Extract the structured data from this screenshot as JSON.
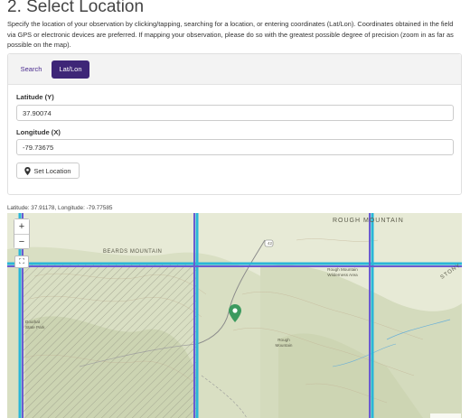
{
  "page": {
    "title": "2. Select Location",
    "instructions": "Specify the location of your observation by clicking/tapping, searching for a location, or entering coordinates (Lat/Lon). Coordinates obtained in the field via GPS or electronic devices are preferred. If mapping your observation, please do so with the greatest possible degree of precision (zoom in as far as possible on the map)."
  },
  "tabs": [
    {
      "label": "Search",
      "active": false
    },
    {
      "label": "Lat/Lon",
      "active": true
    }
  ],
  "form": {
    "latitude_label": "Latitude (Y)",
    "latitude_value": "37.90074",
    "longitude_label": "Longitude (X)",
    "longitude_value": "-79.73675",
    "set_location_label": "Set Location",
    "set_location_icon": "map-marker-icon"
  },
  "map": {
    "coordinate_readout": "Latitude: 37.91178,  Longitude: -79.77585",
    "zoom_in_label": "+",
    "zoom_out_label": "−",
    "fullscreen_label": "⛶",
    "labels": {
      "rough_mountain": "ROUGH MOUNTAIN",
      "beards_mountain": "BEARDS MOUNTAIN",
      "rough_mountain_wilderness": "Rough Mountain Wilderness Area",
      "rough_mountain_small": "Rough Mountain",
      "douthat": "Douthat State Park",
      "road_42": "42",
      "stony": "STONY"
    },
    "colors": {
      "grid_cyan": "#29b6d8",
      "grid_purple": "#6a5bd1",
      "marker": "#3c9a5f",
      "accent_purple": "#3e2677"
    }
  }
}
